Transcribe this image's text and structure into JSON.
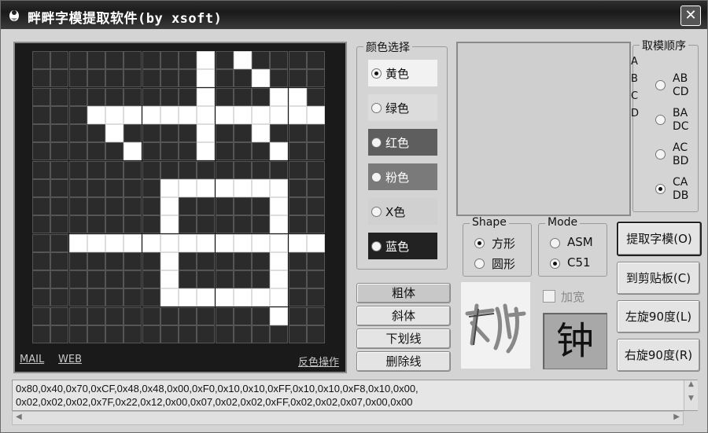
{
  "window": {
    "title": "畔畔字模提取软件(by xsoft)"
  },
  "matrix": {
    "rows": 16,
    "cols": 16,
    "on_rows": [
      "0000000001010000",
      "0000000001001000",
      "0000000001000110",
      "0001111111111111",
      "0000100001001000",
      "0000010001000100",
      "0000000000000000",
      "0000000111111100",
      "0000000100000100",
      "0000000100000100",
      "0011111111111111",
      "0000000100000100",
      "0000000100000100",
      "0000000111111100",
      "0000000000000100",
      "0000000000000000"
    ]
  },
  "links": {
    "mail": "MAIL",
    "web": "WEB",
    "invert": "反色操作"
  },
  "color_group": {
    "legend": "颜色选择",
    "options": [
      {
        "label": "黄色",
        "selected": true,
        "bg": "#f2f2f2"
      },
      {
        "label": "绿色",
        "selected": false,
        "bg": "#dcdcdc"
      },
      {
        "label": "红色",
        "selected": false,
        "bg": "#5e5e5e"
      },
      {
        "label": "粉色",
        "selected": false,
        "bg": "#7a7a7a"
      },
      {
        "label": "X色",
        "selected": false,
        "bg": "#d0d0d0"
      },
      {
        "label": "蓝色",
        "selected": false,
        "bg": "#222222"
      }
    ]
  },
  "order_group": {
    "legend": "取模顺序",
    "side_letters": "A B C D",
    "options": [
      {
        "line1": "AB",
        "line2": "CD",
        "selected": false
      },
      {
        "line1": "BA",
        "line2": "DC",
        "selected": false
      },
      {
        "line1": "AC",
        "line2": "BD",
        "selected": false
      },
      {
        "line1": "CA",
        "line2": "DB",
        "selected": true
      }
    ]
  },
  "shape_group": {
    "legend": "Shape",
    "options": [
      {
        "label": "方形",
        "selected": true
      },
      {
        "label": "圆形",
        "selected": false
      }
    ]
  },
  "mode_group": {
    "legend": "Mode",
    "options": [
      {
        "label": "ASM",
        "selected": false
      },
      {
        "label": "C51",
        "selected": true
      }
    ]
  },
  "style_buttons": {
    "bold": "粗体",
    "italic": "斜体",
    "underline": "下划线",
    "strike": "删除线"
  },
  "widen": {
    "label": "加宽",
    "checked": false
  },
  "glyph_preview": "钟",
  "action_buttons": {
    "extract": "提取字模(O)",
    "copy": "到剪贴板(C)",
    "rotate_left": "左旋90度(L)",
    "rotate_right": "右旋90度(R)"
  },
  "output": {
    "line1": "0x80,0x40,0x70,0xCF,0x48,0x48,0x00,0xF0,0x10,0x10,0xFF,0x10,0x10,0xF8,0x10,0x00,",
    "line2": "0x02,0x02,0x02,0x7F,0x22,0x12,0x00,0x07,0x02,0x02,0xFF,0x02,0x02,0x07,0x00,0x00"
  }
}
